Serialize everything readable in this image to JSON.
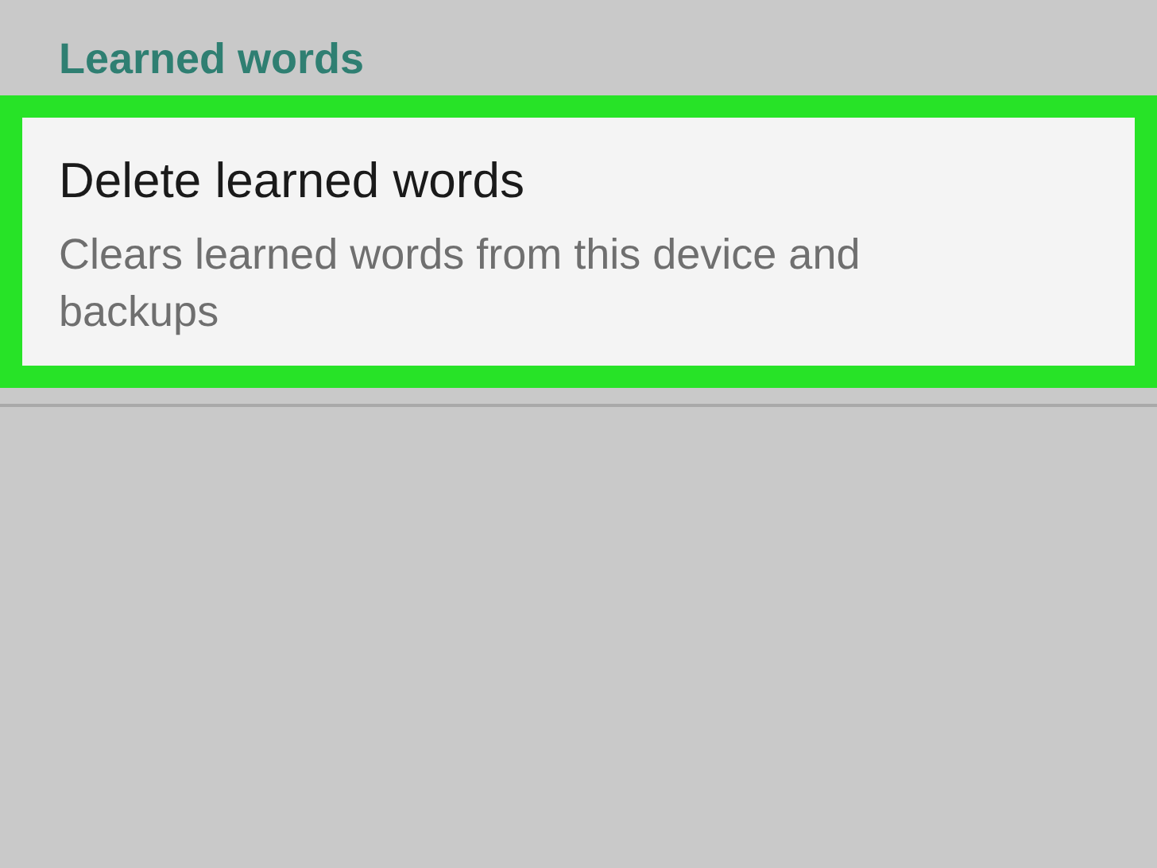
{
  "section_header": "Learned words",
  "settings_items": [
    {
      "title": "Delete learned words",
      "summary": "Clears learned words from this device and backups",
      "highlighted": true
    }
  ]
}
